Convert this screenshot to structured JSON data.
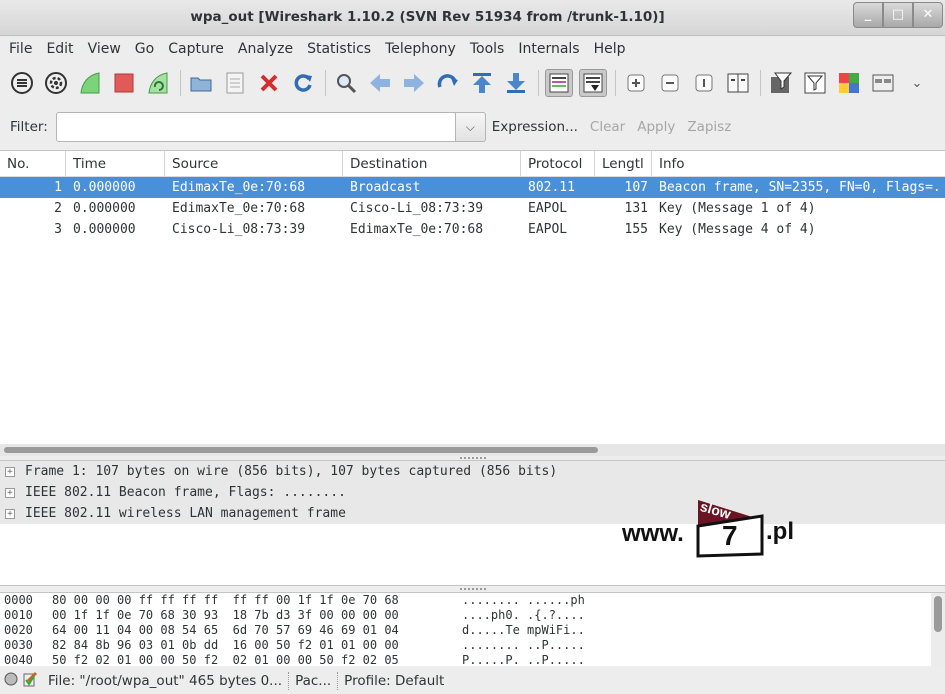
{
  "window": {
    "title": "wpa_out  [Wireshark 1.10.2  (SVN Rev 51934 from /trunk-1.10)]",
    "minimize": "_",
    "maximize": "□",
    "close": "✕"
  },
  "menu": [
    "File",
    "Edit",
    "View",
    "Go",
    "Capture",
    "Analyze",
    "Statistics",
    "Telephony",
    "Tools",
    "Internals",
    "Help"
  ],
  "toolbar": {
    "icons": [
      "interfaces-icon",
      "options-icon",
      "start-capture-icon",
      "stop-capture-icon",
      "restart-capture-icon",
      "open-icon",
      "save-icon",
      "close-file-icon",
      "reload-icon",
      "find-icon",
      "back-icon",
      "forward-icon",
      "goto-icon",
      "first-packet-icon",
      "last-packet-icon",
      "colorize-icon",
      "autoscroll-icon",
      "zoom-in-icon",
      "zoom-out-icon",
      "normal-size-icon",
      "resize-columns-icon",
      "capture-filters-icon",
      "display-filters-icon",
      "coloring-rules-icon",
      "preferences-icon",
      "more-icon"
    ]
  },
  "filter": {
    "label": "Filter:",
    "value": "",
    "expression": "Expression...",
    "clear": "Clear",
    "apply": "Apply",
    "save": "Zapisz"
  },
  "packet_list": {
    "columns": [
      "No.",
      "Time",
      "Source",
      "Destination",
      "Protocol",
      "Lengtl",
      "Info"
    ],
    "rows": [
      {
        "no": "1",
        "time": "0.000000",
        "source": "EdimaxTe_0e:70:68",
        "destination": "Broadcast",
        "protocol": "802.11",
        "length": "107",
        "info": "Beacon frame, SN=2355, FN=0, Flags=."
      },
      {
        "no": "2",
        "time": "0.000000",
        "source": "EdimaxTe_0e:70:68",
        "destination": "Cisco-Li_08:73:39",
        "protocol": "EAPOL",
        "length": "131",
        "info": "Key (Message 1 of 4)"
      },
      {
        "no": "3",
        "time": "0.000000",
        "source": "Cisco-Li_08:73:39",
        "destination": "EdimaxTe_0e:70:68",
        "protocol": "EAPOL",
        "length": "155",
        "info": "Key (Message 4 of 4)"
      }
    ]
  },
  "details": [
    "Frame 1: 107 bytes on wire (856 bits), 107 bytes captured (856 bits)",
    "IEEE 802.11 Beacon frame, Flags: ........",
    "IEEE 802.11 wireless LAN management frame"
  ],
  "watermark": {
    "prefix": "www.",
    "flag_text": "slow",
    "number": "7",
    "suffix": ".pl"
  },
  "hex": [
    {
      "offset": "0000",
      "bytes": "80 00 00 00 ff ff ff ff  ff ff 00 1f 1f 0e 70 68",
      "ascii": "........ ......ph"
    },
    {
      "offset": "0010",
      "bytes": "00 1f 1f 0e 70 68 30 93  18 7b d3 3f 00 00 00 00",
      "ascii": "....ph0. .{.?...."
    },
    {
      "offset": "0020",
      "bytes": "64 00 11 04 00 08 54 65  6d 70 57 69 46 69 01 04",
      "ascii": "d.....Te mpWiFi.."
    },
    {
      "offset": "0030",
      "bytes": "82 84 8b 96 03 01 0b dd  16 00 50 f2 01 01 00 00",
      "ascii": "........ ..P....."
    },
    {
      "offset": "0040",
      "bytes": "50 f2 02 01 00 00 50 f2  02 01 00 00 50 f2 02 05",
      "ascii": "P.....P. ..P....."
    }
  ],
  "status": {
    "file": "File: \"/root/wpa_out\" 465 bytes 0...",
    "packets": "Pac...",
    "profile": "Profile: Default"
  }
}
